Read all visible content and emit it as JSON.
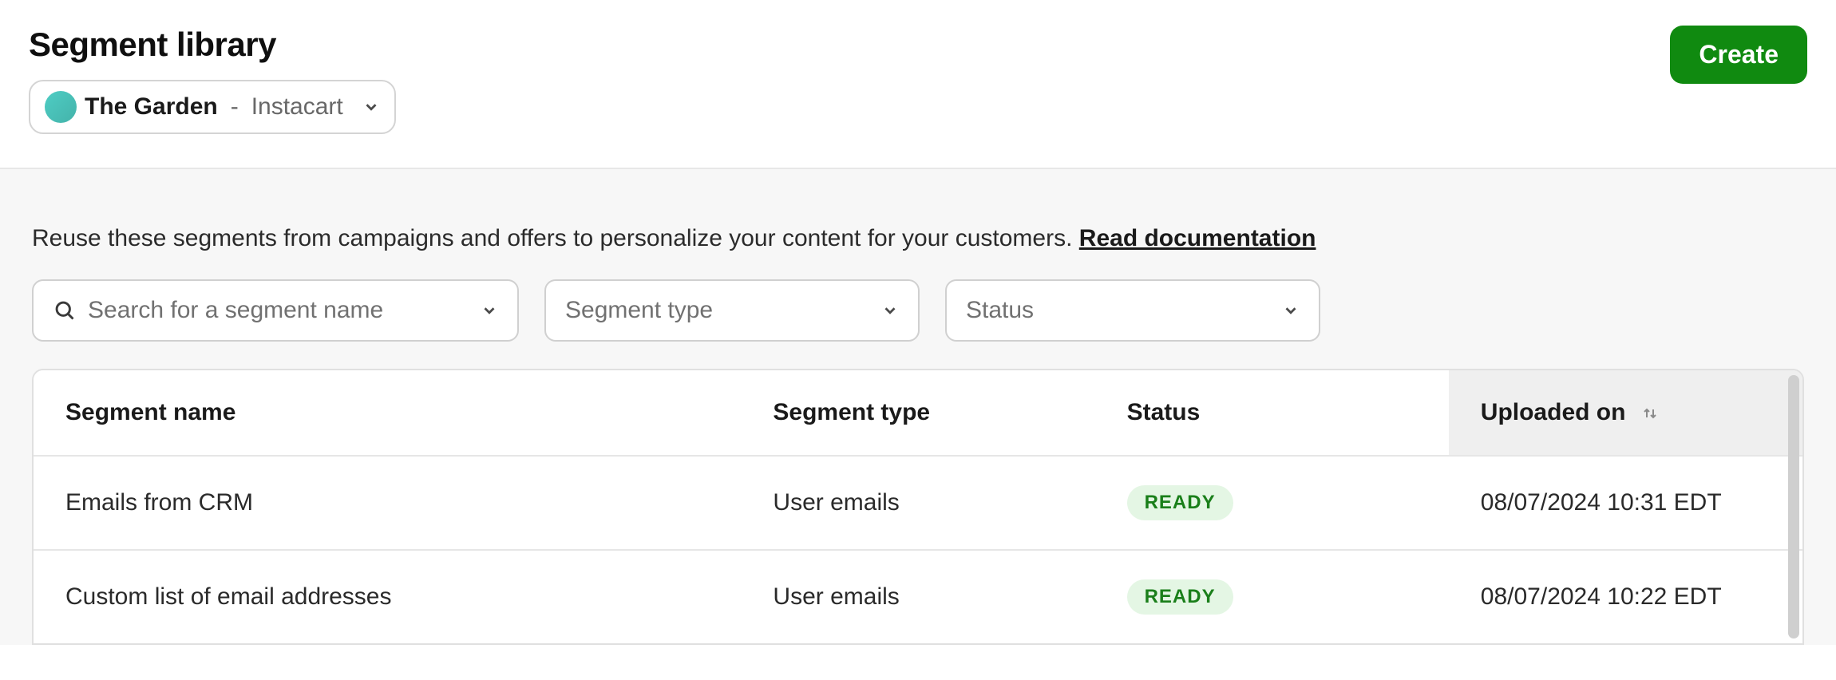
{
  "header": {
    "title": "Segment library",
    "create_label": "Create",
    "brand": {
      "name": "The Garden",
      "separator": "-",
      "sub": "Instacart"
    },
    "brand_accent": "#4ecdc4"
  },
  "body": {
    "description_text": "Reuse these segments from campaigns and offers to personalize your content for your customers. ",
    "doc_link_text": "Read documentation"
  },
  "filters": {
    "search_placeholder": "Search for a segment name",
    "type_label": "Segment type",
    "status_label": "Status"
  },
  "table": {
    "columns": {
      "name": "Segment name",
      "type": "Segment type",
      "status": "Status",
      "uploaded": "Uploaded on"
    },
    "rows": [
      {
        "name": "Emails from CRM",
        "type": "User emails",
        "status": "READY",
        "uploaded": "08/07/2024 10:31 EDT"
      },
      {
        "name": "Custom list of email addresses",
        "type": "User emails",
        "status": "READY",
        "uploaded": "08/07/2024 10:22 EDT"
      }
    ]
  },
  "colors": {
    "create_bg": "#108a10",
    "badge_bg": "#e4f6e4",
    "badge_fg": "#1a7f1a"
  }
}
